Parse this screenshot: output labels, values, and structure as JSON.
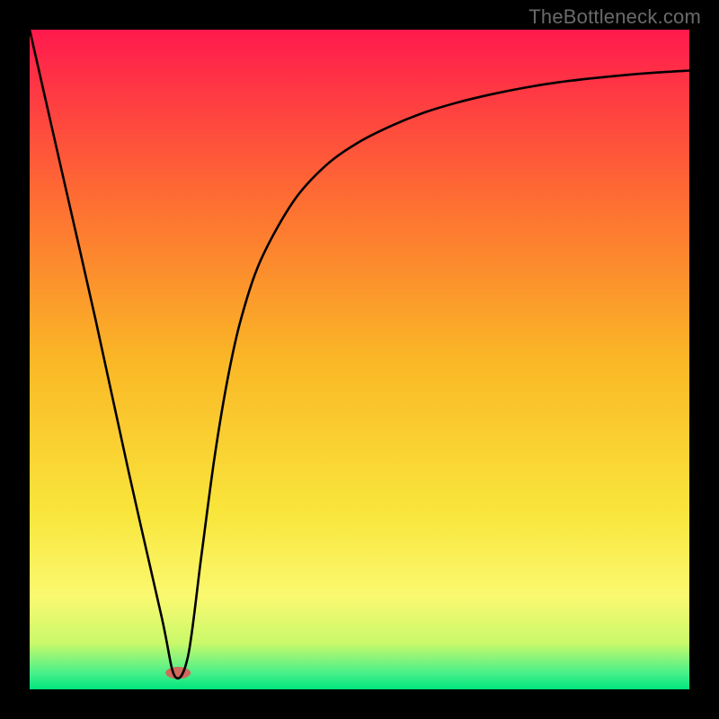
{
  "watermark": "TheBottleneck.com",
  "chart_data": {
    "type": "line",
    "title": "",
    "xlabel": "",
    "ylabel": "",
    "xlim": [
      0,
      100
    ],
    "ylim": [
      0,
      100
    ],
    "grid": false,
    "legend": false,
    "background_gradient": {
      "stops": [
        {
          "pos": 0.0,
          "color": "#ff1a4d"
        },
        {
          "pos": 0.25,
          "color": "#fe6b33"
        },
        {
          "pos": 0.5,
          "color": "#fab726"
        },
        {
          "pos": 0.73,
          "color": "#f9e53b"
        },
        {
          "pos": 0.86,
          "color": "#faf970"
        },
        {
          "pos": 0.93,
          "color": "#c9f96a"
        },
        {
          "pos": 0.975,
          "color": "#4af08a"
        },
        {
          "pos": 1.0,
          "color": "#00e57e"
        }
      ]
    },
    "notch": {
      "x_center_frac": 0.225,
      "y_frac": 0.975,
      "rx_frac": 0.019,
      "ry_frac": 0.009,
      "color": "#d06a5a"
    },
    "series": [
      {
        "name": "curve",
        "x": [
          0,
          5,
          10,
          15,
          20,
          22,
          24,
          26,
          28,
          30,
          32,
          35,
          40,
          45,
          50,
          55,
          60,
          65,
          70,
          75,
          80,
          85,
          90,
          95,
          100
        ],
        "y": [
          100,
          78,
          56,
          33,
          11,
          2,
          5,
          20,
          35,
          47,
          56,
          65,
          74,
          79.5,
          83,
          85.5,
          87.5,
          89,
          90.2,
          91.2,
          92,
          92.6,
          93.1,
          93.5,
          93.8
        ]
      }
    ]
  }
}
